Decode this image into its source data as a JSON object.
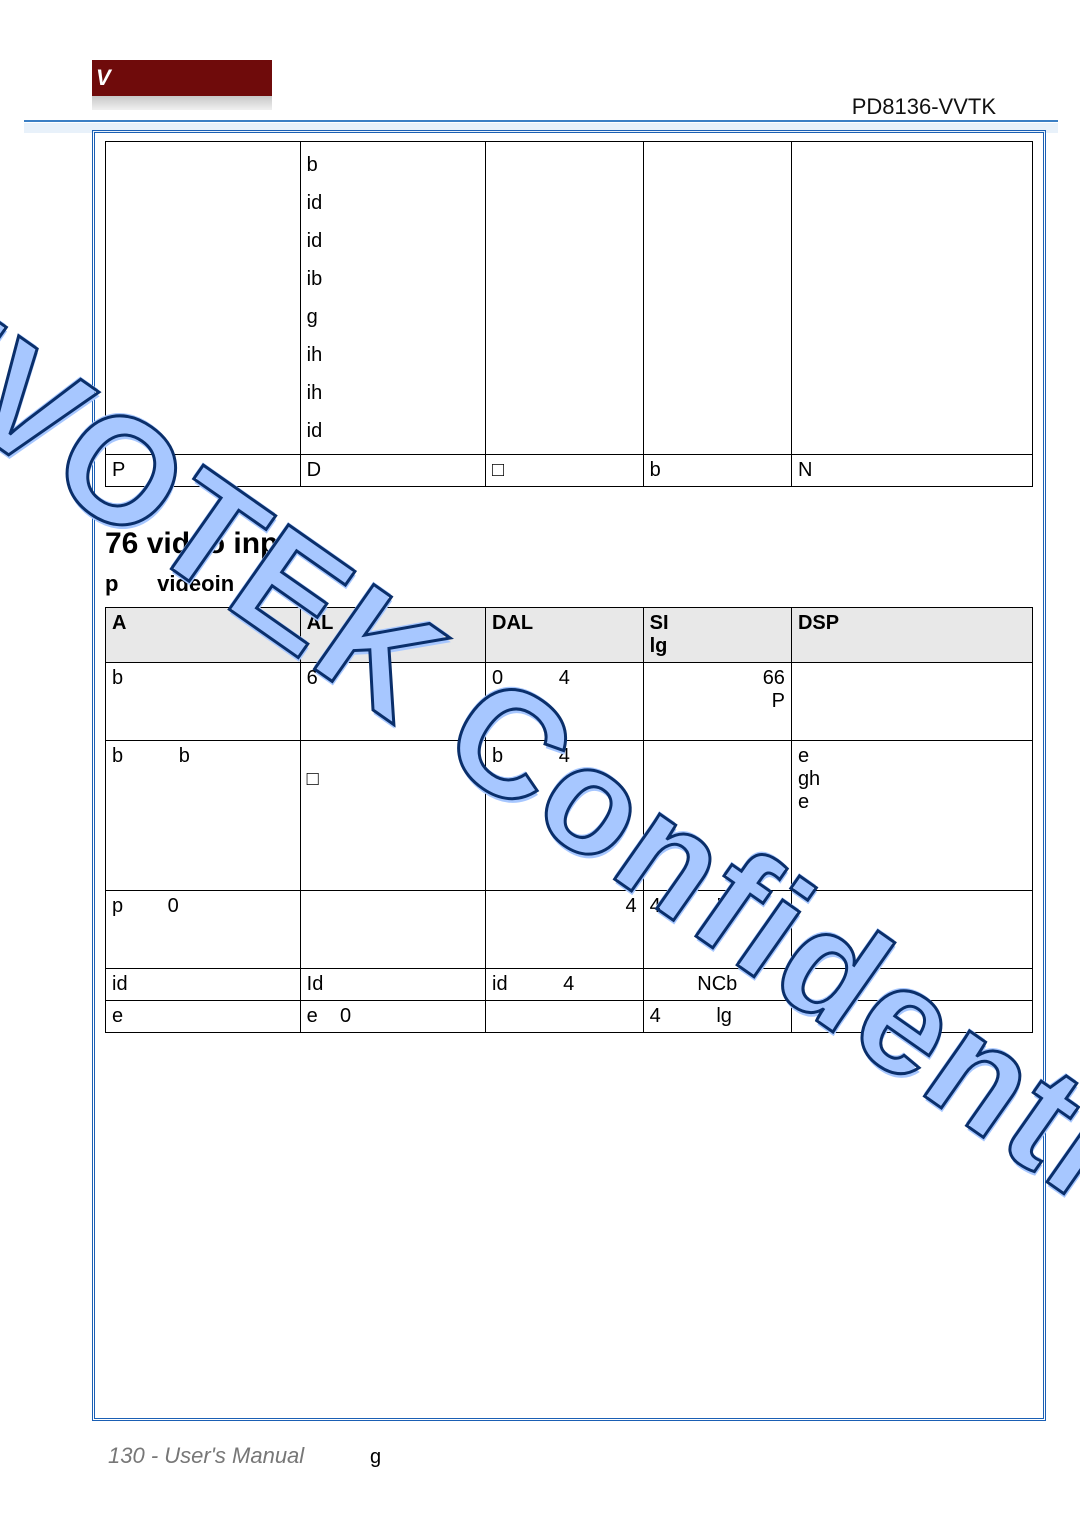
{
  "header": {
    "logo_letter": "V",
    "model": "PD8136-VVTK"
  },
  "table1": {
    "r1c1": "",
    "r1c2_lines": [
      "b",
      "id",
      "id",
      "ib",
      "g",
      "ih",
      "ih",
      "id"
    ],
    "r1c3": "",
    "r1c4": "",
    "r1c5": "",
    "r2c1": "P",
    "r2c2": "D",
    "r2c3": "□",
    "r2c4": "b",
    "r2c5": "N"
  },
  "section": {
    "heading": "76 video input",
    "group_prefix": "p",
    "group_name": "videoin"
  },
  "table2": {
    "headers": [
      "A",
      "AL",
      "DAL",
      "SI\nlg",
      "DSP"
    ],
    "rows": [
      {
        "c1": "b",
        "c2": "6",
        "c3": "0          4",
        "c4": "66\nP",
        "c5": ""
      },
      {
        "c1": "b          b",
        "c2": "\n□",
        "c3": "b          4",
        "c4": "",
        "c5": "e\ngh\ne"
      },
      {
        "c1": "p        0",
        "c2": "",
        "c3": "4",
        "c4": "4          P",
        "c5": ""
      },
      {
        "c1": "id",
        "c2": "Id",
        "c3": "id          4",
        "c4": "NCb",
        "c5": ""
      },
      {
        "c1": "e",
        "c2": "e    0",
        "c3": "",
        "c4": "4          lg",
        "c5": ""
      }
    ]
  },
  "watermark_text": "VIVOTEK Confidential",
  "footer": {
    "text": "130 - User's Manual",
    "page_mark": "g"
  }
}
